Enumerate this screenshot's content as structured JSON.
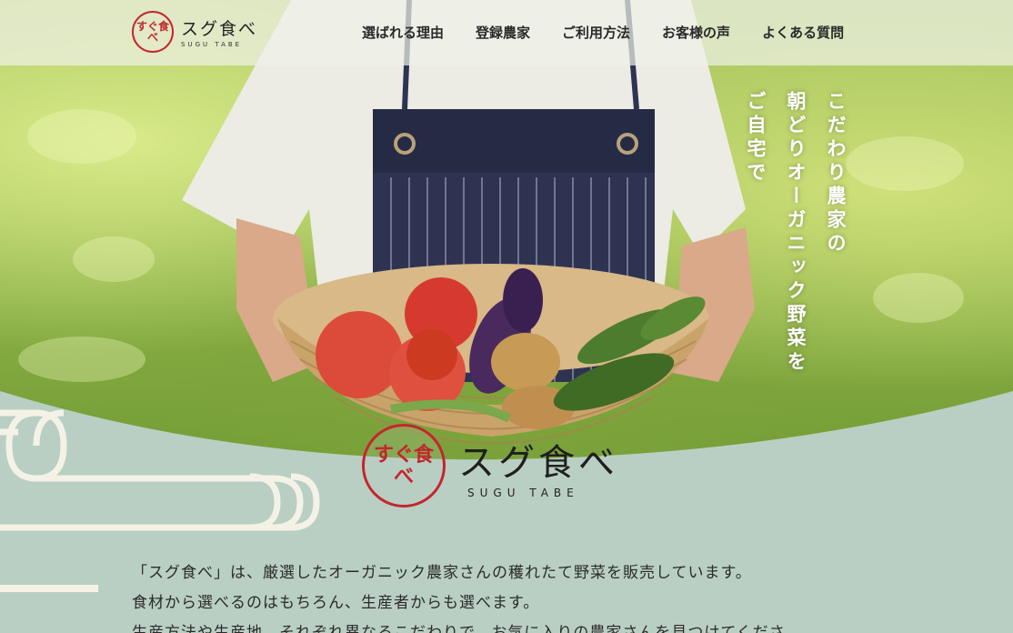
{
  "header": {
    "logo_mark": "すぐ食べ",
    "logo_name": "スグ食べ",
    "logo_sub": "SUGU TABE",
    "nav": [
      "選ばれる理由",
      "登録農家",
      "ご利用方法",
      "お客様の声",
      "よくある質問"
    ]
  },
  "hero": {
    "tagline": [
      "こだわり農家の",
      "朝どりオーガニック野菜を",
      "ご自宅で"
    ]
  },
  "brand": {
    "mark": "すぐ食べ",
    "name": "スグ食べ",
    "sub": "SUGU TABE"
  },
  "intro": [
    "「スグ食べ」は、厳選したオーガニック農家さんの穫れたて野菜を販売しています。",
    "食材から選べるのはもちろん、生産者からも選べます。",
    "生産方法や生産地、それぞれ異なるこだわりで、お気に入りの農家さんを見つけてくださ"
  ],
  "colors": {
    "sage": "#b9cfc3",
    "accent_red": "#c4262e",
    "cream": "#f4f2e6"
  }
}
